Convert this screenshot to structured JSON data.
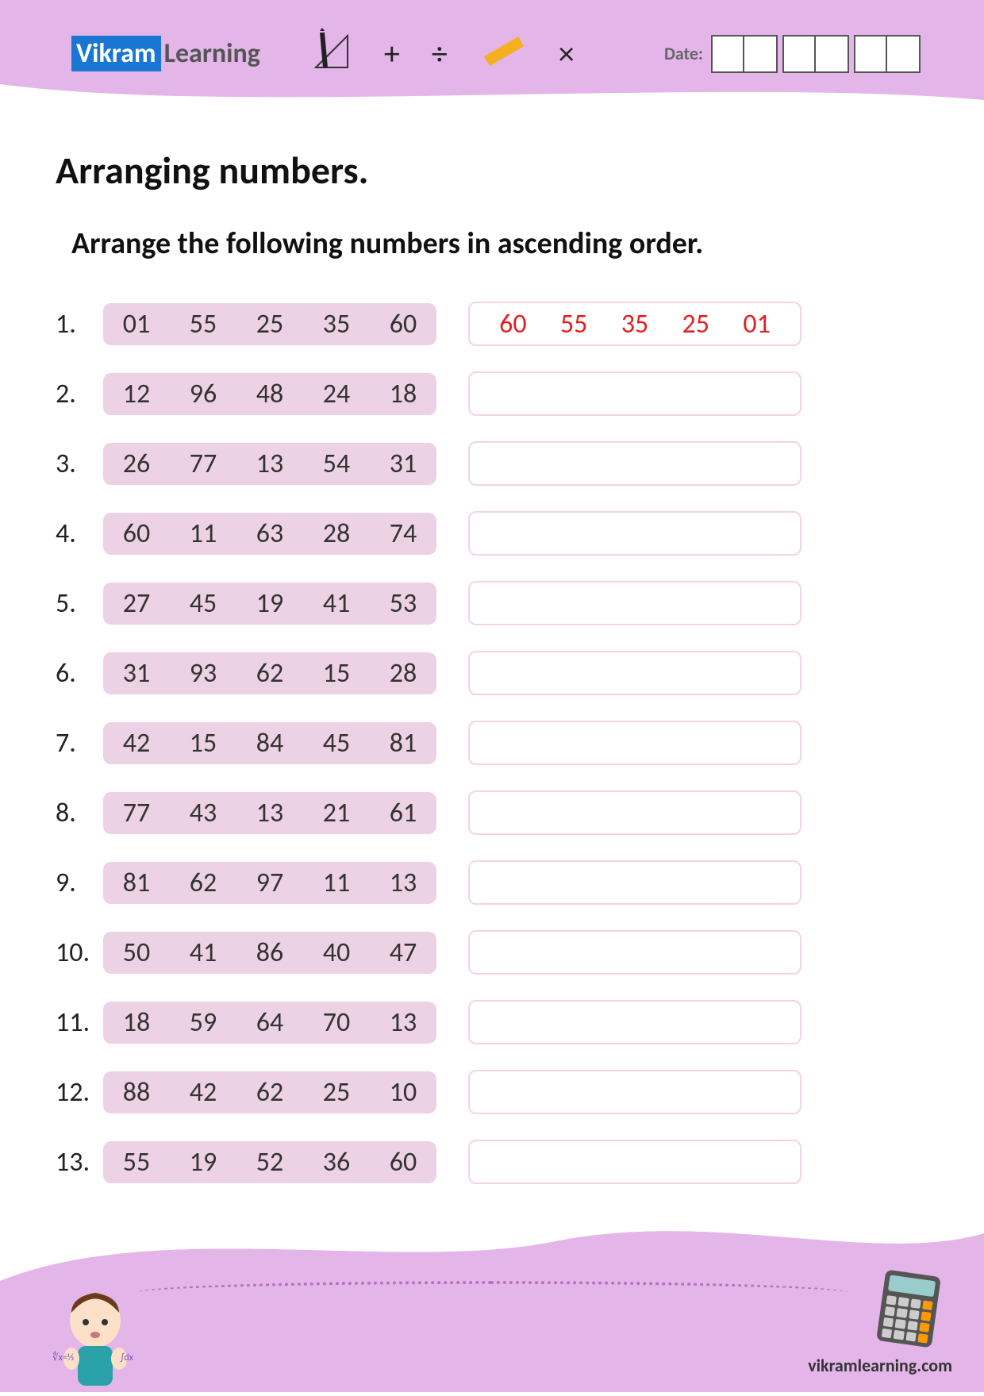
{
  "brand": {
    "part1": "Vikram",
    "part2": "Learning"
  },
  "symbols": {
    "plus": "+",
    "divide": "÷",
    "times": "×"
  },
  "date_label": "Date:",
  "title": "Arranging numbers.",
  "subtitle": "Arrange the following numbers in ascending order.",
  "rows": [
    {
      "n": "1.",
      "vals": [
        "01",
        "55",
        "25",
        "35",
        "60"
      ],
      "ans": [
        "60",
        "55",
        "35",
        "25",
        "01"
      ]
    },
    {
      "n": "2.",
      "vals": [
        "12",
        "96",
        "48",
        "24",
        "18"
      ],
      "ans": []
    },
    {
      "n": "3.",
      "vals": [
        "26",
        "77",
        "13",
        "54",
        "31"
      ],
      "ans": []
    },
    {
      "n": "4.",
      "vals": [
        "60",
        "11",
        "63",
        "28",
        "74"
      ],
      "ans": []
    },
    {
      "n": "5.",
      "vals": [
        "27",
        "45",
        "19",
        "41",
        "53"
      ],
      "ans": []
    },
    {
      "n": "6.",
      "vals": [
        "31",
        "93",
        "62",
        "15",
        "28"
      ],
      "ans": []
    },
    {
      "n": "7.",
      "vals": [
        "42",
        "15",
        "84",
        "45",
        "81"
      ],
      "ans": []
    },
    {
      "n": "8.",
      "vals": [
        "77",
        "43",
        "13",
        "21",
        "61"
      ],
      "ans": []
    },
    {
      "n": "9.",
      "vals": [
        "81",
        "62",
        "97",
        "11",
        "13"
      ],
      "ans": []
    },
    {
      "n": "10.",
      "vals": [
        "50",
        "41",
        "86",
        "40",
        "47"
      ],
      "ans": []
    },
    {
      "n": "11.",
      "vals": [
        "18",
        "59",
        "64",
        "70",
        "13"
      ],
      "ans": []
    },
    {
      "n": "12.",
      "vals": [
        "88",
        "42",
        "62",
        "25",
        "10"
      ],
      "ans": []
    },
    {
      "n": "13.",
      "vals": [
        "55",
        "19",
        "52",
        "36",
        "60"
      ],
      "ans": []
    }
  ],
  "footer_url": "vikramlearning.com"
}
